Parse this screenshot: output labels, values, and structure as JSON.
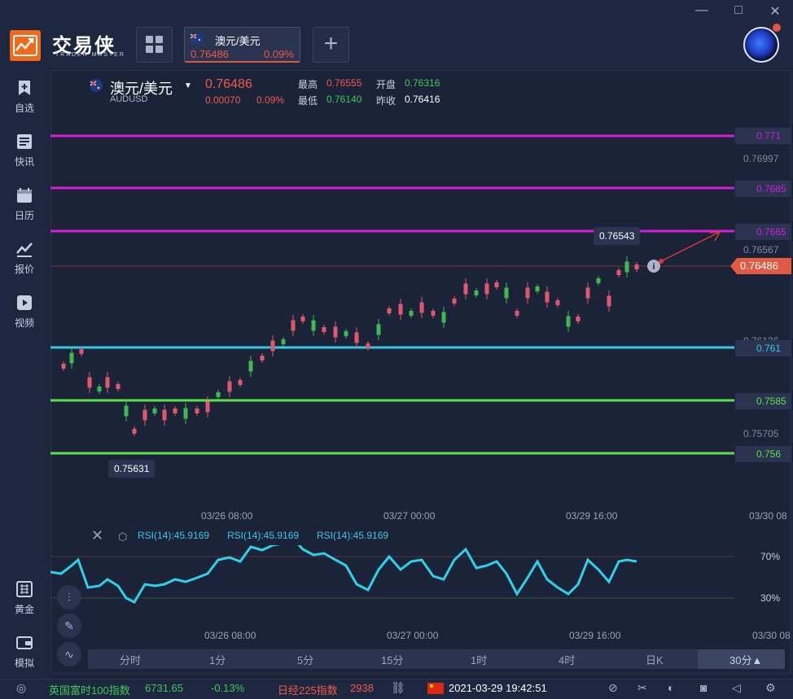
{
  "app": {
    "brand": "交易侠",
    "brand_sub": "TRADER MASTER",
    "window_controls": [
      "—",
      "□",
      "✕"
    ],
    "accent": "#f06a1a"
  },
  "tab": {
    "name": "澳元/美元",
    "price": "0.76486",
    "pct": "0.09%"
  },
  "sidebar": {
    "items": [
      {
        "label": "自选",
        "icon": "bookmark-add-icon"
      },
      {
        "label": "快讯",
        "icon": "news-icon"
      },
      {
        "label": "日历",
        "icon": "calendar-icon"
      },
      {
        "label": "报价",
        "icon": "quote-chart-icon"
      },
      {
        "label": "视频",
        "icon": "video-play-icon"
      },
      {
        "label": "黄金",
        "icon": "gold-icon"
      },
      {
        "label": "模拟",
        "icon": "wallet-icon"
      }
    ]
  },
  "symbol": {
    "name": "澳元/美元",
    "code": "AUDUSD",
    "price": "0.76486",
    "change": "0.00070",
    "pct": "0.09%",
    "high_label": "最高",
    "high": "0.76555",
    "open_label": "开盘",
    "open": "0.76316",
    "low_label": "最低",
    "low": "0.76140",
    "prev_label": "昨收",
    "prev": "0.76416"
  },
  "price_axis": {
    "levels": [
      {
        "value": "0.771",
        "color": "#d21fd8"
      },
      {
        "value": "0.7685",
        "color": "#d21fd8"
      },
      {
        "value": "0.7665",
        "color": "#d21fd8"
      },
      {
        "value": "0.761",
        "color": "#35c9e6"
      },
      {
        "value": "0.7585",
        "color": "#5fe04a"
      },
      {
        "value": "0.756",
        "color": "#5fe04a"
      }
    ],
    "ticks": [
      "0.76997",
      "0.76567",
      "0.76136",
      "0.75705"
    ],
    "current": "0.76486",
    "high_callout": "0.76543",
    "low_callout": "0.75631"
  },
  "time_axis": {
    "labels": [
      "03/26 08:00",
      "03/27 00:00",
      "03/29 16:00",
      "03/30 08"
    ]
  },
  "rsi": {
    "labels": [
      "RSI(14):45.9169",
      "RSI(14):45.9169",
      "RSI(14):45.9169"
    ],
    "levels": [
      "70%",
      "30%"
    ],
    "color": "#2fd0e8"
  },
  "timeframes": {
    "items": [
      "分时",
      "1分",
      "5分",
      "15分",
      "1时",
      "4时",
      "日K"
    ],
    "active": "30分▲"
  },
  "status": {
    "ticker1_name": "英国富时100指数",
    "ticker1_value": "6731.65",
    "ticker1_pct": "-0.13%",
    "ticker2_name": "日经225指数",
    "ticker2_value": "2938",
    "datetime": "2021-03-29 19:42:51"
  }
}
